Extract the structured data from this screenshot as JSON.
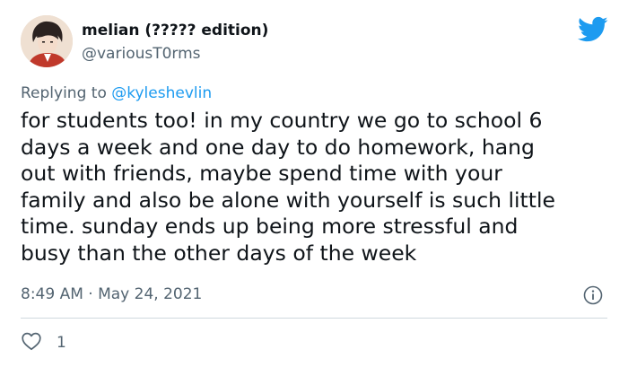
{
  "tweet": {
    "author": {
      "display_name": "melian (????? edition)",
      "handle": "@variousT0rms"
    },
    "reply_prefix": "Replying to ",
    "reply_to": "@kyleshevlin",
    "text_lines": [
      "for students too! in my country we go to school 6",
      "days a week and one day to do homework, hang",
      "out with friends, maybe spend time with your",
      "family and also be alone with yourself is such little",
      "time. sunday ends up being more stressful and",
      "busy than the other days of the week"
    ],
    "timestamp": "8:49 AM · May 24, 2021",
    "like_count": "1"
  },
  "colors": {
    "twitter_blue": "#1d9bf0",
    "secondary_text": "#536471",
    "divider": "#cfd9de"
  },
  "icons": {
    "brand": "twitter-bird-icon",
    "info": "info-icon",
    "like": "heart-icon"
  }
}
